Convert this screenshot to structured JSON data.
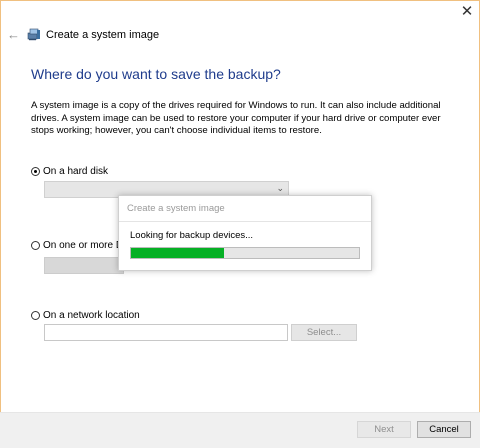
{
  "window": {
    "title": "Create a system image",
    "close_icon": "close-icon",
    "back_icon": "back-arrow-icon",
    "app_icon": "system-image-icon"
  },
  "main": {
    "heading": "Where do you want to save the backup?",
    "description": "A system image is a copy of the drives required for Windows to run. It can also include additional drives. A system image can be used to restore your computer if your hard drive or computer ever stops working; however, you can't choose individual items to restore.",
    "options": [
      {
        "label": "On a hard disk",
        "selected": true
      },
      {
        "label": "On one or more DV",
        "selected": false
      },
      {
        "label": "On a network location",
        "selected": false
      }
    ],
    "hard_disk_dropdown": {
      "value": ""
    },
    "network_location": {
      "value": "",
      "select_label": "Select..."
    }
  },
  "popup": {
    "title": "Create a system image",
    "message": "Looking for backup devices...",
    "progress_fraction": 0.41,
    "progress_color": "#06b025"
  },
  "footer": {
    "next_label": "Next",
    "cancel_label": "Cancel"
  },
  "colors": {
    "heading": "#1f3c8c",
    "accent_border": "#f0c080"
  }
}
